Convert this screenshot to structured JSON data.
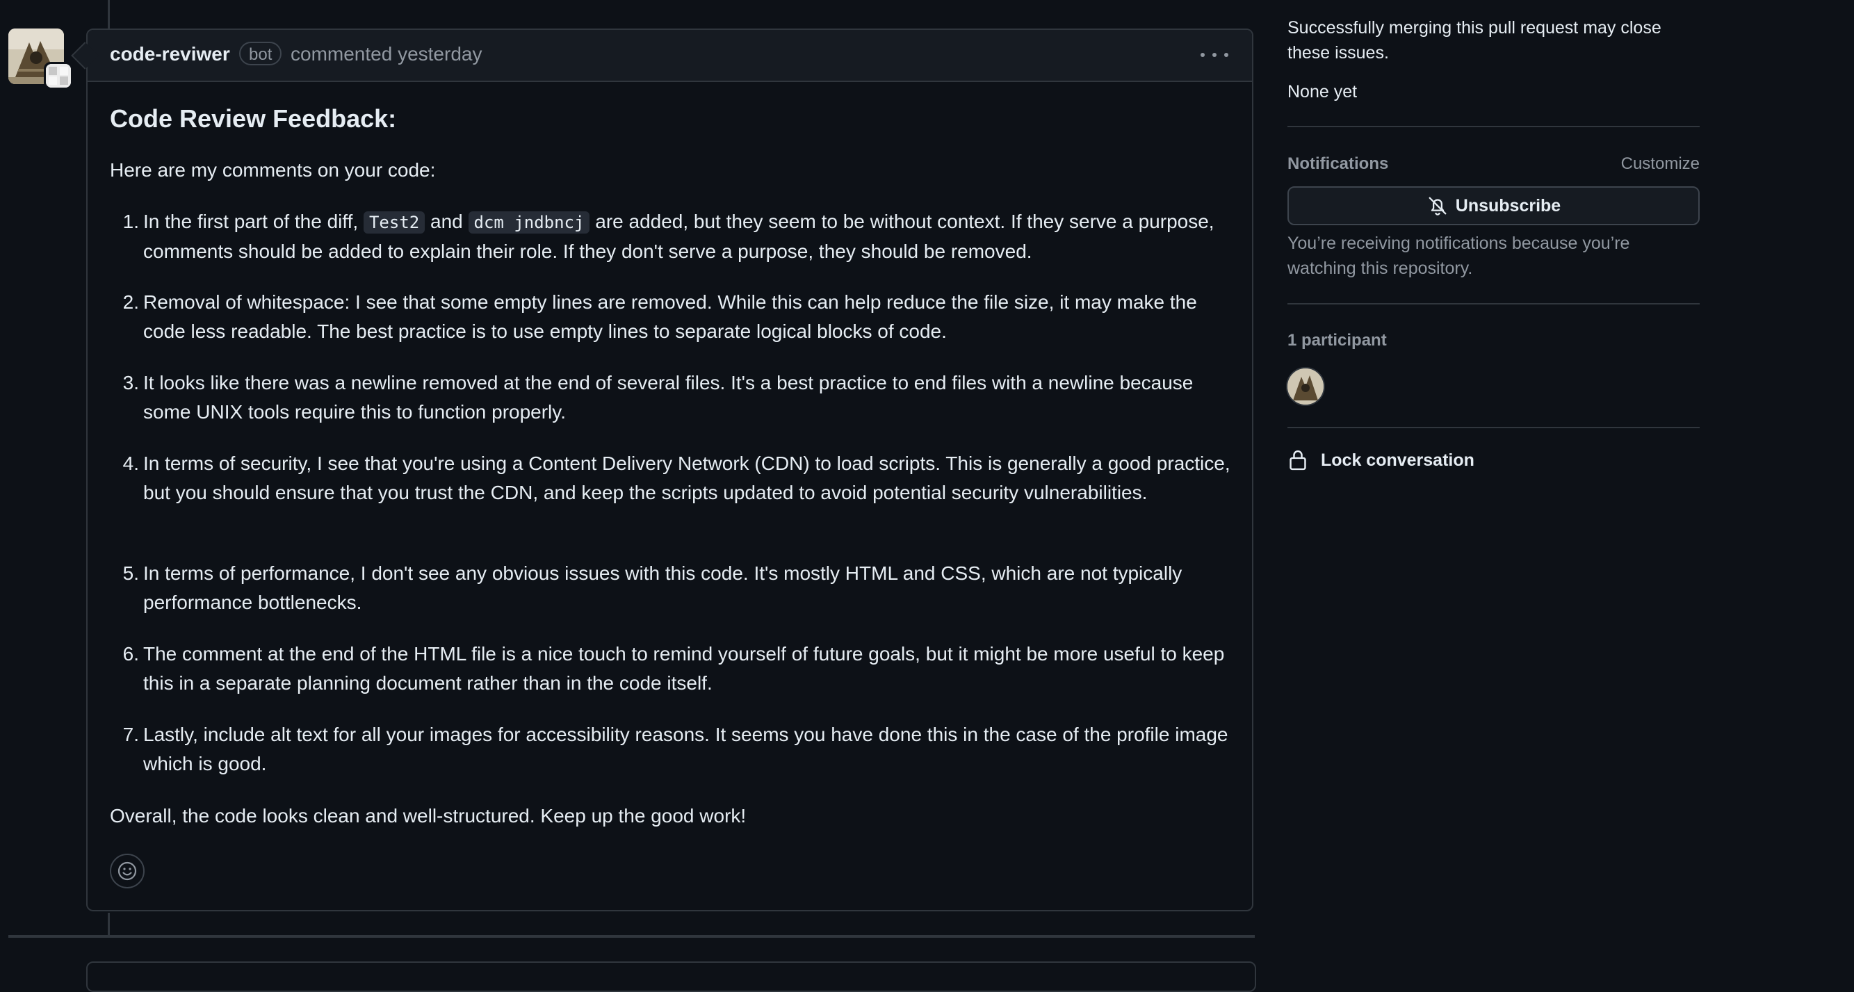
{
  "comment": {
    "author": "code-reviwer",
    "badge": "bot",
    "action_time": "commented yesterday",
    "title": "Code Review Feedback:",
    "intro": "Here are my comments on your code:",
    "items": [
      {
        "number": "1.",
        "before": "In the first part of the diff, ",
        "code1": "Test2",
        "middle": " and ",
        "code2": "dcm jndbncj",
        "after": " are added, but they seem to be without context. If they serve a purpose, comments should be added to explain their role. If they don't serve a purpose, they should be removed."
      },
      {
        "number": "2.",
        "text": "Removal of whitespace: I see that some empty lines are removed. While this can help reduce the file size, it may make the code less readable. The best practice is to use empty lines to separate logical blocks of code."
      },
      {
        "number": "3.",
        "text": "It looks like there was a newline removed at the end of several files. It's a best practice to end files with a newline because some UNIX tools require this to function properly."
      },
      {
        "number": "4.",
        "text": "In terms of security, I see that you're using a Content Delivery Network (CDN) to load scripts. This is generally a good practice, but you should ensure that you trust the CDN, and keep the scripts updated to avoid potential security vulnerabilities."
      },
      {
        "number": "5.",
        "text": "In terms of performance, I don't see any obvious issues with this code. It's mostly HTML and CSS, which are not typically performance bottlenecks."
      },
      {
        "number": "6.",
        "text": "The comment at the end of the HTML file is a nice touch to remind yourself of future goals, but it might be more useful to keep this in a separate planning document rather than in the code itself."
      },
      {
        "number": "7.",
        "text": "Lastly, include alt text for all your images for accessibility reasons. It seems you have done this in the case of the profile image which is good."
      }
    ],
    "outro": "Overall, the code looks clean and well-structured. Keep up the good work!"
  },
  "sidebar": {
    "development_note": "Successfully merging this pull request may close these issues.",
    "development_value": "None yet",
    "notifications_heading": "Notifications",
    "customize_label": "Customize",
    "unsubscribe_label": "Unsubscribe",
    "notification_reason": "You’re receiving notifications because you’re watching this repository.",
    "participants_heading": "1 participant",
    "lock_label": "Lock conversation"
  },
  "colors": {
    "background": "#0d1117",
    "header_bg": "#161b22",
    "border": "#30363d",
    "text": "#e6edf3",
    "muted": "#9198a1"
  },
  "icons": [
    "kebab-menu-icon",
    "smiley-icon",
    "bell-slash-icon",
    "lock-icon"
  ]
}
